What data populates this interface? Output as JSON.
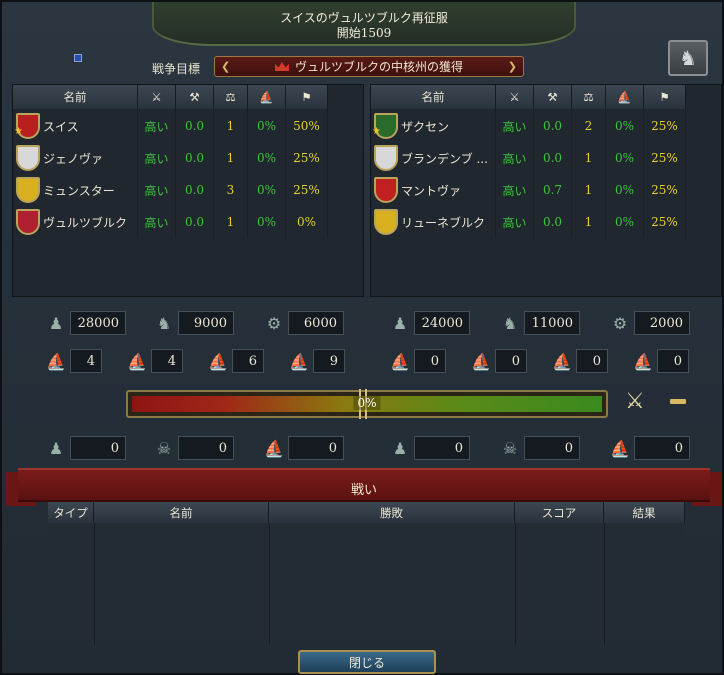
{
  "header": {
    "title": "スイスのヴュルツブルク再征服",
    "start": "開始1509"
  },
  "war_goal": {
    "label": "戦争目標",
    "value": "ヴュルツブルクの中核州の獲得"
  },
  "columns": {
    "name": "名前"
  },
  "attackers": [
    {
      "name": "スイス",
      "col1": "高い",
      "col2": "0.0",
      "col3": "1",
      "col4": "0%",
      "col5": "50%",
      "shield": "#b82020",
      "leader": true
    },
    {
      "name": "ジェノヴァ",
      "col1": "高い",
      "col2": "0.0",
      "col3": "1",
      "col4": "0%",
      "col5": "25%",
      "shield": "#d8d8d8"
    },
    {
      "name": "ミュンスター",
      "col1": "高い",
      "col2": "0.0",
      "col3": "3",
      "col4": "0%",
      "col5": "25%",
      "shield": "#d8b020"
    },
    {
      "name": "ヴュルツブルク",
      "col1": "高い",
      "col2": "0.0",
      "col3": "1",
      "col4": "0%",
      "col5": "0%",
      "shield": "#b02030"
    }
  ],
  "defenders": [
    {
      "name": "ザクセン",
      "col1": "高い",
      "col2": "0.0",
      "col3": "2",
      "col4": "0%",
      "col5": "25%",
      "shield": "#2a6a2a",
      "leader": true
    },
    {
      "name": "ブランデンブ ...",
      "col1": "高い",
      "col2": "0.0",
      "col3": "1",
      "col4": "0%",
      "col5": "25%",
      "shield": "#d8d8d8"
    },
    {
      "name": "マントヴァ",
      "col1": "高い",
      "col2": "0.7",
      "col3": "1",
      "col4": "0%",
      "col5": "25%",
      "shield": "#c02020"
    },
    {
      "name": "リューネブルク",
      "col1": "高い",
      "col2": "0.0",
      "col3": "1",
      "col4": "0%",
      "col5": "25%",
      "shield": "#d8b020"
    }
  ],
  "attacker_army": {
    "infantry": "28000",
    "cavalry": "9000",
    "artillery": "6000",
    "heavy": "4",
    "light": "4",
    "galley": "6",
    "transport": "9",
    "inf_loss": "0",
    "cav_loss": "0",
    "ship_loss": "0"
  },
  "defender_army": {
    "infantry": "24000",
    "cavalry": "11000",
    "artillery": "2000",
    "heavy": "0",
    "light": "0",
    "galley": "0",
    "transport": "0",
    "inf_loss": "0",
    "cav_loss": "0",
    "ship_loss": "0"
  },
  "warscore": {
    "value": "0%",
    "fraction": 0.5
  },
  "battles": {
    "title": "戦い",
    "columns": [
      "タイプ",
      "名前",
      "勝敗",
      "スコア",
      "結果"
    ]
  },
  "close_label": "閉じる"
}
